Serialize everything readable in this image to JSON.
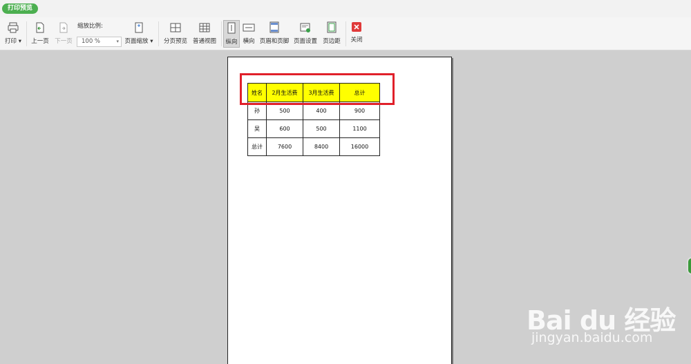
{
  "window": {
    "tab_label": "打印预览"
  },
  "toolbar": {
    "print": "打印",
    "prev_page": "上一页",
    "next_page": "下一页",
    "zoom_label": "缩放比例:",
    "zoom_value": "100 %",
    "page_zoom": "页面缩放",
    "page_break_preview": "分页预览",
    "normal_view": "普通视图",
    "portrait": "纵向",
    "landscape": "横向",
    "header_footer": "页眉和页脚",
    "page_setup": "页面设置",
    "margins": "页边距",
    "close": "关闭"
  },
  "sheet": {
    "headers": [
      "姓名",
      "2月生活费",
      "3月生活费",
      "总计"
    ],
    "rows": [
      [
        "孙",
        "500",
        "400",
        "900"
      ],
      [
        "吴",
        "600",
        "500",
        "1100"
      ],
      [
        "总计",
        "7600",
        "8400",
        "16000"
      ]
    ]
  },
  "colors": {
    "header_fill": "#ffff00",
    "highlight": "#e0202a",
    "tab_green": "#4caf50",
    "close_red": "#e03a3a"
  },
  "watermark": {
    "brand": "Bai du 经验",
    "url": "jingyan.baidu.com"
  }
}
